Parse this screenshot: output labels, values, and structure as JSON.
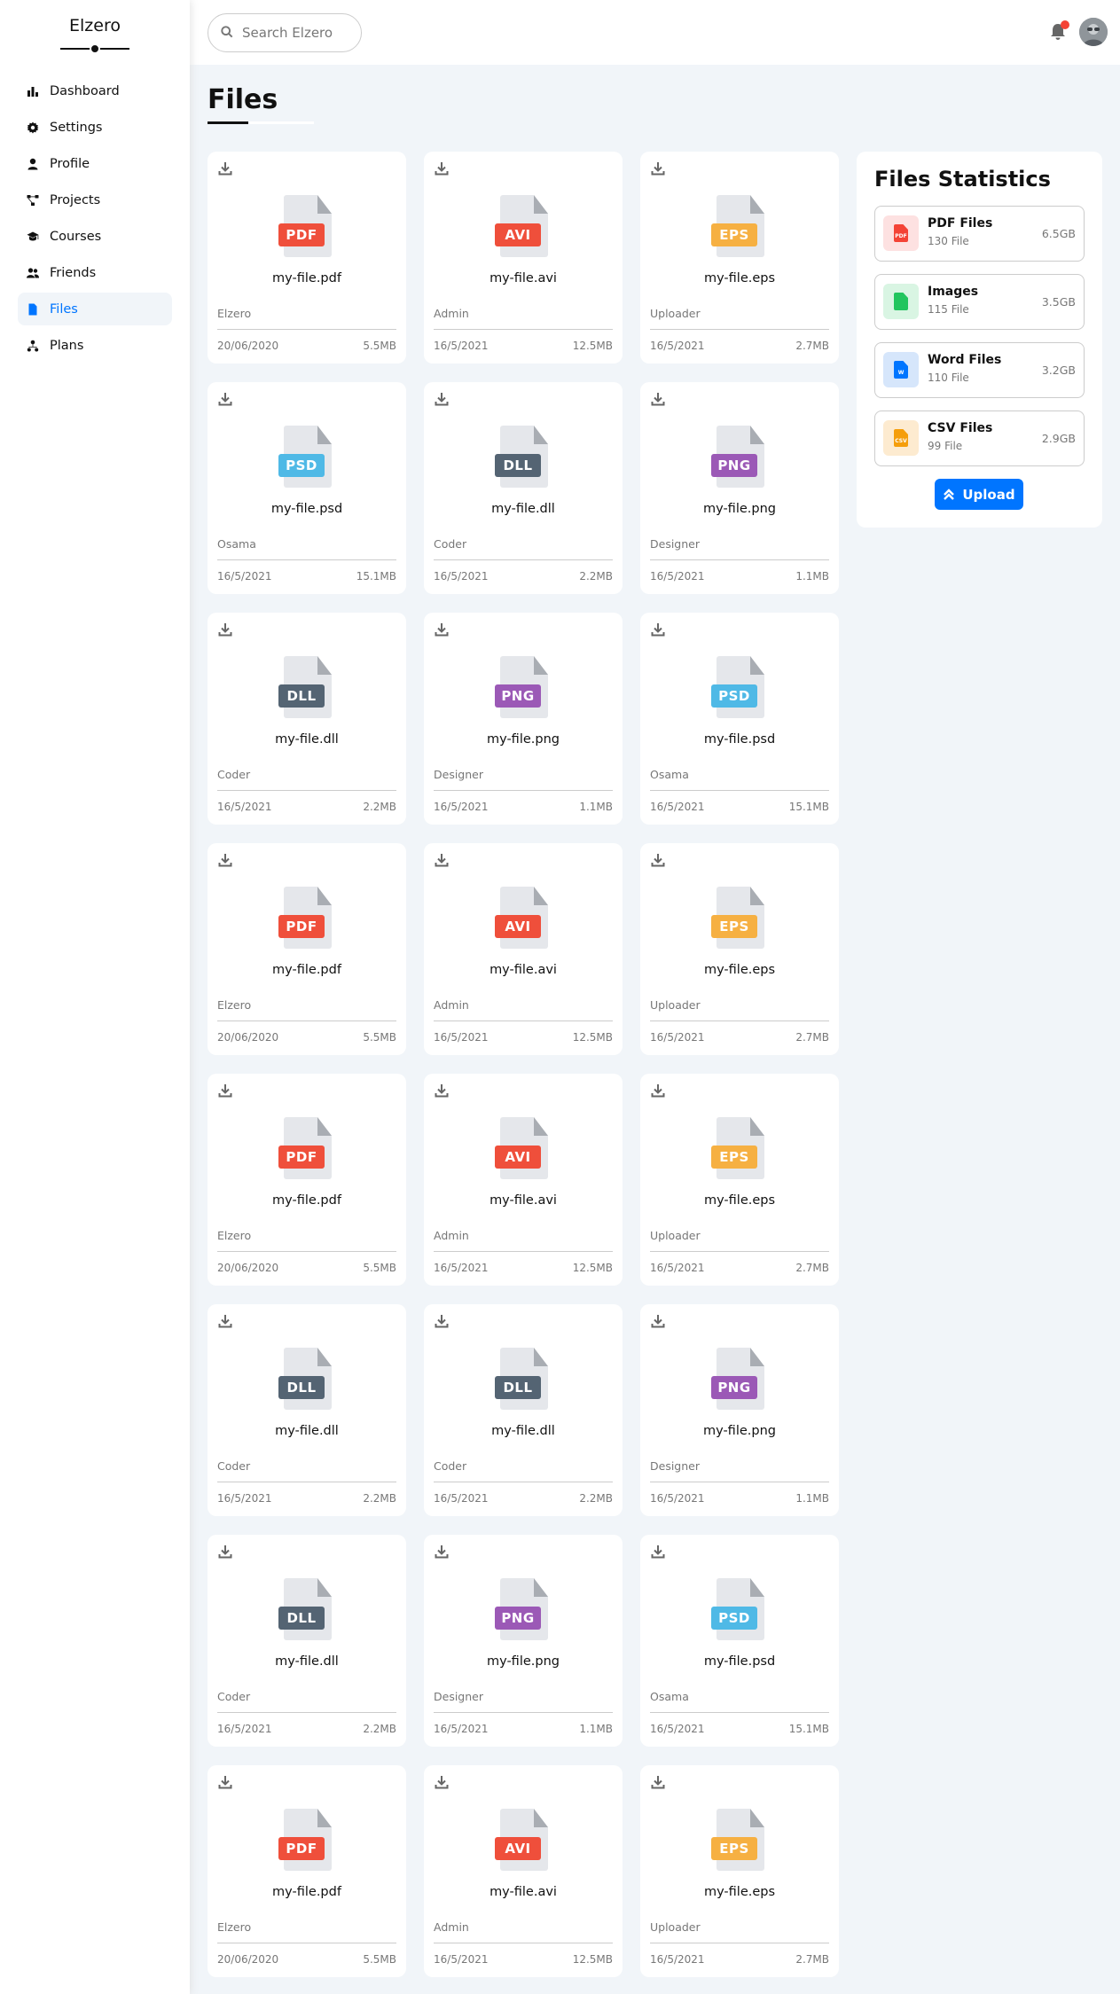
{
  "brand": "Elzero",
  "nav": [
    {
      "label": "Dashboard",
      "icon": "chart-bar-icon",
      "active": false
    },
    {
      "label": "Settings",
      "icon": "gear-icon",
      "active": false
    },
    {
      "label": "Profile",
      "icon": "user-icon",
      "active": false
    },
    {
      "label": "Projects",
      "icon": "diagram-project-icon",
      "active": false
    },
    {
      "label": "Courses",
      "icon": "graduation-cap-icon",
      "active": false
    },
    {
      "label": "Friends",
      "icon": "users-icon",
      "active": false
    },
    {
      "label": "Files",
      "icon": "file-icon",
      "active": true
    },
    {
      "label": "Plans",
      "icon": "sitemap-icon",
      "active": false
    }
  ],
  "search": {
    "placeholder": "Search Elzero"
  },
  "page_title": "Files",
  "colors": {
    "accent": "#0075ff",
    "pdf": "#ef4f3b",
    "avi": "#ef4f3b",
    "eps": "#f6b042",
    "psd": "#4fb9e6",
    "dll": "#546473",
    "png": "#9b59b6"
  },
  "files": [
    {
      "ext": "PDF",
      "name": "my-file.pdf",
      "owner": "Elzero",
      "date": "20/06/2020",
      "size": "5.5MB"
    },
    {
      "ext": "AVI",
      "name": "my-file.avi",
      "owner": "Admin",
      "date": "16/5/2021",
      "size": "12.5MB"
    },
    {
      "ext": "EPS",
      "name": "my-file.eps",
      "owner": "Uploader",
      "date": "16/5/2021",
      "size": "2.7MB"
    },
    {
      "ext": "PSD",
      "name": "my-file.psd",
      "owner": "Osama",
      "date": "16/5/2021",
      "size": "15.1MB"
    },
    {
      "ext": "DLL",
      "name": "my-file.dll",
      "owner": "Coder",
      "date": "16/5/2021",
      "size": "2.2MB"
    },
    {
      "ext": "PNG",
      "name": "my-file.png",
      "owner": "Designer",
      "date": "16/5/2021",
      "size": "1.1MB"
    },
    {
      "ext": "DLL",
      "name": "my-file.dll",
      "owner": "Coder",
      "date": "16/5/2021",
      "size": "2.2MB"
    },
    {
      "ext": "PNG",
      "name": "my-file.png",
      "owner": "Designer",
      "date": "16/5/2021",
      "size": "1.1MB"
    },
    {
      "ext": "PSD",
      "name": "my-file.psd",
      "owner": "Osama",
      "date": "16/5/2021",
      "size": "15.1MB"
    },
    {
      "ext": "PDF",
      "name": "my-file.pdf",
      "owner": "Elzero",
      "date": "20/06/2020",
      "size": "5.5MB"
    },
    {
      "ext": "AVI",
      "name": "my-file.avi",
      "owner": "Admin",
      "date": "16/5/2021",
      "size": "12.5MB"
    },
    {
      "ext": "EPS",
      "name": "my-file.eps",
      "owner": "Uploader",
      "date": "16/5/2021",
      "size": "2.7MB"
    },
    {
      "ext": "PDF",
      "name": "my-file.pdf",
      "owner": "Elzero",
      "date": "20/06/2020",
      "size": "5.5MB"
    },
    {
      "ext": "AVI",
      "name": "my-file.avi",
      "owner": "Admin",
      "date": "16/5/2021",
      "size": "12.5MB"
    },
    {
      "ext": "EPS",
      "name": "my-file.eps",
      "owner": "Uploader",
      "date": "16/5/2021",
      "size": "2.7MB"
    },
    {
      "ext": "DLL",
      "name": "my-file.dll",
      "owner": "Coder",
      "date": "16/5/2021",
      "size": "2.2MB"
    },
    {
      "ext": "DLL",
      "name": "my-file.dll",
      "owner": "Coder",
      "date": "16/5/2021",
      "size": "2.2MB"
    },
    {
      "ext": "PNG",
      "name": "my-file.png",
      "owner": "Designer",
      "date": "16/5/2021",
      "size": "1.1MB"
    },
    {
      "ext": "DLL",
      "name": "my-file.dll",
      "owner": "Coder",
      "date": "16/5/2021",
      "size": "2.2MB"
    },
    {
      "ext": "PNG",
      "name": "my-file.png",
      "owner": "Designer",
      "date": "16/5/2021",
      "size": "1.1MB"
    },
    {
      "ext": "PSD",
      "name": "my-file.psd",
      "owner": "Osama",
      "date": "16/5/2021",
      "size": "15.1MB"
    },
    {
      "ext": "PDF",
      "name": "my-file.pdf",
      "owner": "Elzero",
      "date": "20/06/2020",
      "size": "5.5MB"
    },
    {
      "ext": "AVI",
      "name": "my-file.avi",
      "owner": "Admin",
      "date": "16/5/2021",
      "size": "12.5MB"
    },
    {
      "ext": "EPS",
      "name": "my-file.eps",
      "owner": "Uploader",
      "date": "16/5/2021",
      "size": "2.7MB"
    }
  ],
  "stats": {
    "title": "Files Statistics",
    "items": [
      {
        "name": "PDF Files",
        "count": "130 File",
        "size": "6.5GB",
        "icon": "pdf-file-icon",
        "bg": "#fde1e1",
        "fg": "#f44336",
        "mini": "PDF"
      },
      {
        "name": "Images",
        "count": "115 File",
        "size": "3.5GB",
        "icon": "image-file-icon",
        "bg": "#d9f5e3",
        "fg": "#22c55e",
        "mini": ""
      },
      {
        "name": "Word Files",
        "count": "110 File",
        "size": "3.2GB",
        "icon": "word-file-icon",
        "bg": "#d6e6fb",
        "fg": "#0075ff",
        "mini": "W"
      },
      {
        "name": "CSV Files",
        "count": "99 File",
        "size": "2.9GB",
        "icon": "csv-file-icon",
        "bg": "#fdebd0",
        "fg": "#f59e0b",
        "mini": "CSV"
      }
    ],
    "upload_label": "Upload"
  }
}
